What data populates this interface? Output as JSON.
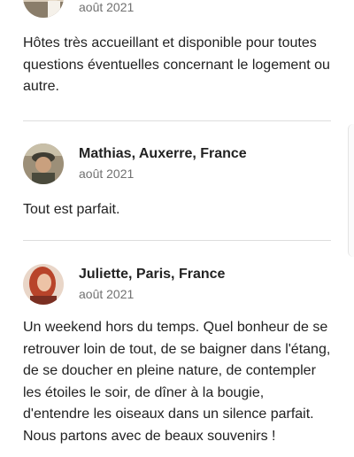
{
  "reviews": [
    {
      "name": "",
      "date": "août 2021",
      "text": "Hôtes très accueillant et disponible pour toutes questions éventuelles concernant le logement ou autre.",
      "avatar_colors": [
        "#8a7d6a",
        "#c9b79c",
        "#e8dccb"
      ]
    },
    {
      "name": "Mathias, Auxerre, France",
      "date": "août 2021",
      "text": "Tout est parfait.",
      "avatar_colors": [
        "#5b5a46",
        "#a08e74",
        "#d9c7a8"
      ]
    },
    {
      "name": "Juliette, Paris, France",
      "date": "août 2021",
      "text": "Un weekend hors du temps. Quel bonheur de se retrouver loin de tout, de se baigner dans l'étang, de se doucher en pleine nature, de contempler les étoiles le soir, de dîner à la bougie, d'entendre les oiseaux dans un silence parfait. Nous partons avec de beaux souvenirs !",
      "avatar_colors": [
        "#b8442a",
        "#e0a98c",
        "#f3e3d6"
      ]
    }
  ]
}
